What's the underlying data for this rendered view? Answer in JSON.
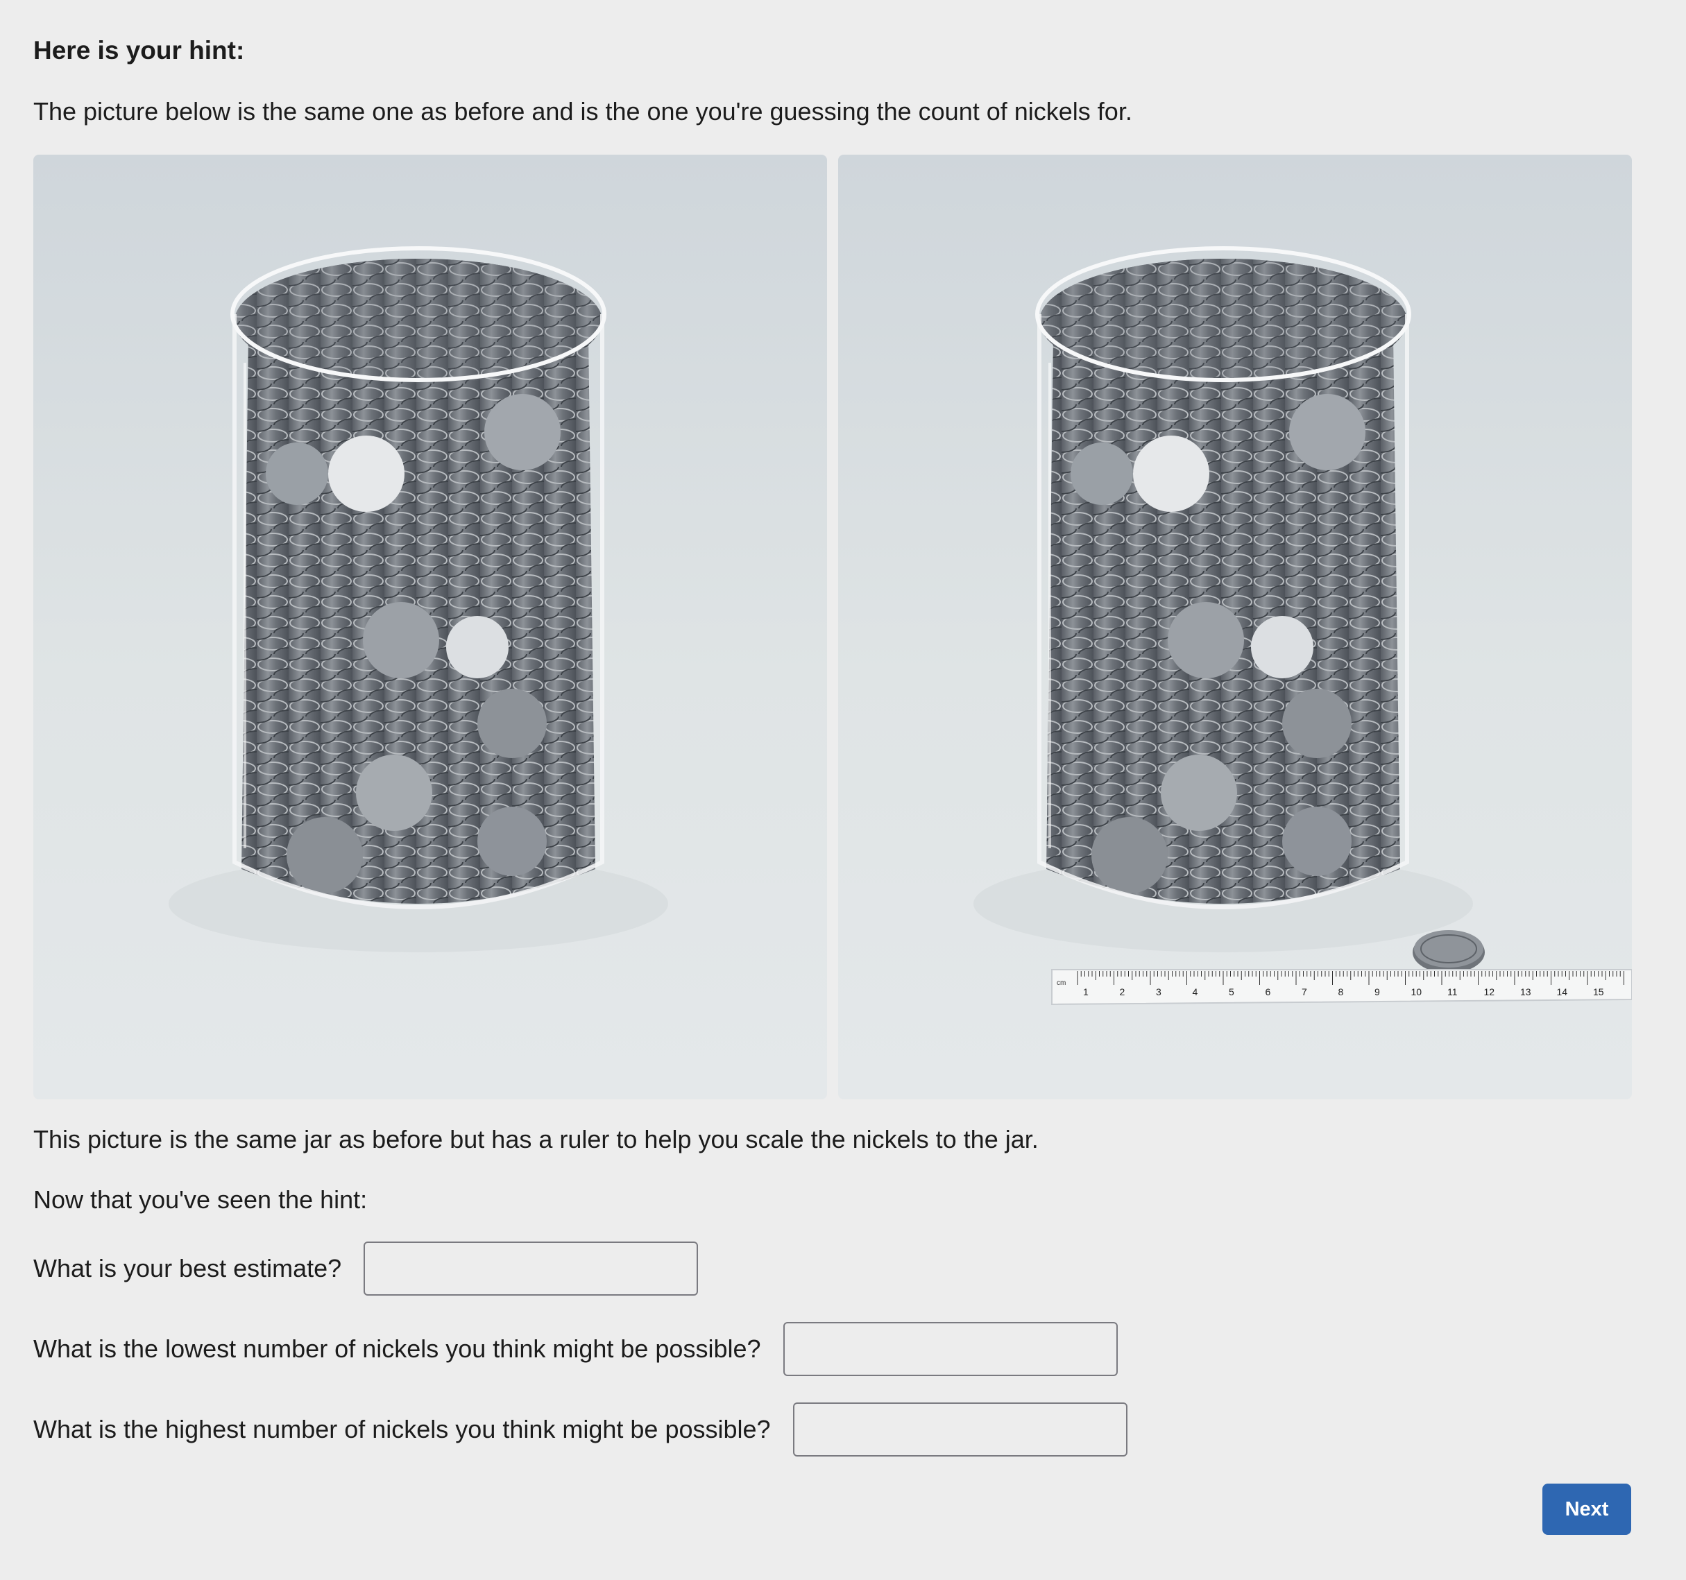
{
  "hint": {
    "title": "Here is your hint:",
    "intro": "The picture below is the same one as before and is the one you're guessing the count of nickels for."
  },
  "images": {
    "left": {
      "alt": "Glass jar filled with nickels"
    },
    "right": {
      "alt": "Same jar of nickels with a ruler and a single nickel for scale",
      "ruler_unit": "cm",
      "ruler_numbers": [
        "1",
        "2",
        "3",
        "4",
        "5",
        "6",
        "7",
        "8",
        "9",
        "10",
        "11",
        "12",
        "13",
        "14",
        "15",
        "1"
      ]
    }
  },
  "caption": "This picture is the same jar as before but has a ruler to help you scale the nickels to the jar.",
  "now_text": "Now that you've seen the hint:",
  "questions": {
    "best_estimate": {
      "label": "What is your best estimate?",
      "value": ""
    },
    "lowest": {
      "label": "What is the lowest number of nickels you think might be possible?",
      "value": ""
    },
    "highest": {
      "label": "What is the highest number of nickels you think might be possible?",
      "value": ""
    }
  },
  "next_button": {
    "label": "Next",
    "color": "#2e67b2"
  }
}
